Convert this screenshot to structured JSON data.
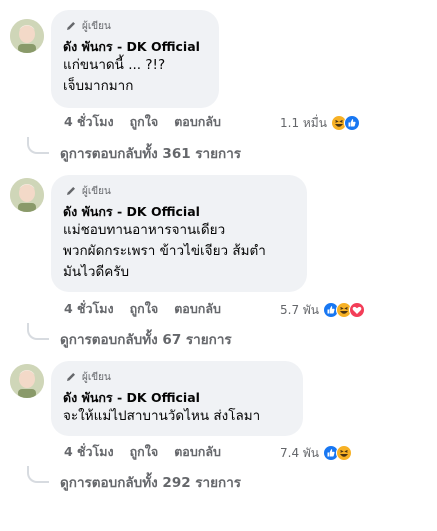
{
  "comments": [
    {
      "author_badge": "ผู้เขียน",
      "author_name": "ดัง พันกร - DK Official",
      "lines": [
        "แก่ขนาดนี้ ... ?!?",
        "เจ็บมากมาก"
      ],
      "time": "4 ชั่วโมง",
      "like_label": "ถูกใจ",
      "reply_label": "ตอบกลับ",
      "reaction_count": "1.1 หมื่น",
      "reactions": [
        "haha",
        "like"
      ],
      "view_replies": "ดูการตอบกลับทั้ง 361 รายการ"
    },
    {
      "author_badge": "ผู้เขียน",
      "author_name": "ดัง พันกร - DK Official",
      "lines": [
        "แม่ชอบทานอาหารจานเดียว",
        "พวกผัดกระเพรา ข้าวไข่เจียว ส้มตำ",
        "มันไวดีครับ"
      ],
      "time": "4 ชั่วโมง",
      "like_label": "ถูกใจ",
      "reply_label": "ตอบกลับ",
      "reaction_count": "5.7 พัน",
      "reactions": [
        "like",
        "haha",
        "love"
      ],
      "view_replies": "ดูการตอบกลับทั้ง 67 รายการ"
    },
    {
      "author_badge": "ผู้เขียน",
      "author_name": "ดัง พันกร - DK Official",
      "lines": [
        "จะให้แม่ไปสาบานวัดไหน ส่งโลมา"
      ],
      "time": "4 ชั่วโมง",
      "like_label": "ถูกใจ",
      "reply_label": "ตอบกลับ",
      "reaction_count": "7.4 พัน",
      "reactions": [
        "like",
        "haha"
      ],
      "view_replies": "ดูการตอบกลับทั้ง 292 รายการ"
    }
  ],
  "colors": {
    "bubble": "#f0f2f5",
    "secondary_text": "#65676b",
    "like_blue": "#1877f2",
    "haha_yellow": "#f7b125",
    "love_red": "#f33e58"
  },
  "icons": {
    "author_badge": "pencil-icon",
    "avatar": "avatar-photo",
    "reactions": [
      "like-reaction-icon",
      "haha-reaction-icon",
      "love-reaction-icon"
    ]
  }
}
